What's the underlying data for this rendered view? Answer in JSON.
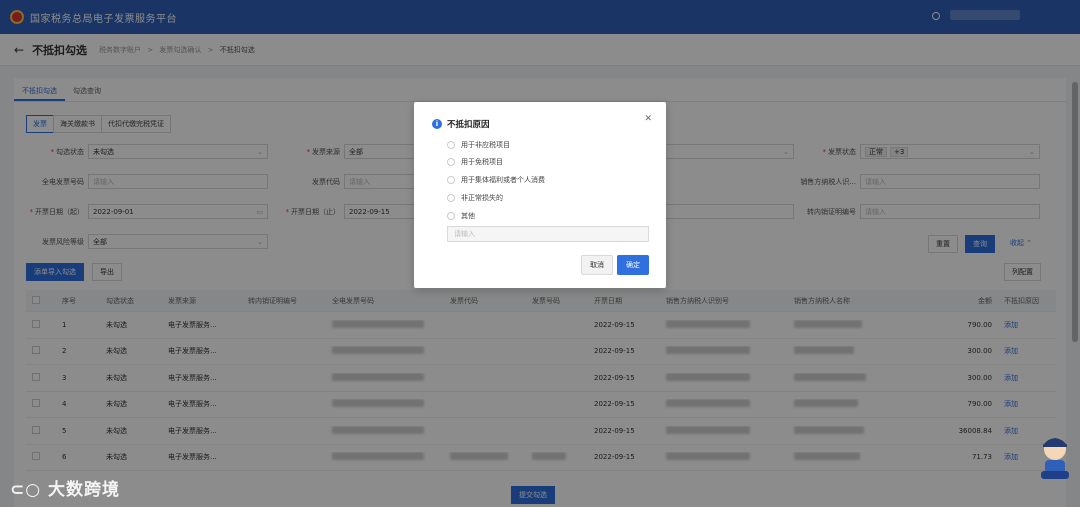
{
  "app": {
    "title": "国家税务总局电子发票服务平台"
  },
  "header": {
    "back_label": "←",
    "page_title": "不抵扣勾选",
    "breadcrumb": [
      "税务数字账户",
      "发票勾选确认",
      "不抵扣勾选"
    ],
    "breadcrumb_sep": ">"
  },
  "tabs": [
    "不抵扣勾选",
    "勾选查询"
  ],
  "subtabs": [
    "发票",
    "海关缴款书",
    "代扣代缴完税凭证"
  ],
  "filters": {
    "gouxuan_status": {
      "label": "勾选状态",
      "value": "未勾选"
    },
    "fapiao_source": {
      "label": "发票来源",
      "value": "全部"
    },
    "fapiao_status": {
      "label": "发票状态",
      "value": "正常",
      "extra": "+3"
    },
    "full_number": {
      "label": "全电发票号码",
      "placeholder": "请输入"
    },
    "fapiao_code": {
      "label": "发票代码",
      "placeholder": "请输入"
    },
    "seller_id": {
      "label": "销售方纳税人识...",
      "placeholder": "请输入"
    },
    "date_start": {
      "label": "开票日期（起）",
      "value": "2022-09-01"
    },
    "date_end": {
      "label": "开票日期（止）",
      "value": "2022-09-15"
    },
    "transfer_no": {
      "label": "转内销证明编号",
      "placeholder": "请输入"
    },
    "risk_level": {
      "label": "发票风险等级",
      "value": "全部"
    }
  },
  "buttons": {
    "reset": "重置",
    "query": "查询",
    "collapse": "收起",
    "add_import": "添单导入勾选",
    "export": "导出",
    "column_config": "列配置",
    "submit": "提交勾选"
  },
  "table": {
    "columns": [
      "序号",
      "勾选状态",
      "发票来源",
      "转内销证明编号",
      "全电发票号码",
      "发票代码",
      "发票号码",
      "开票日期",
      "销售方纳税人识别号",
      "销售方纳税人名称",
      "金额",
      "不抵扣原因"
    ],
    "rows": [
      {
        "no": "1",
        "status": "未勾选",
        "source": "电子发票服务...",
        "date": "2022-09-15",
        "amount": "790.00",
        "action": "添加"
      },
      {
        "no": "2",
        "status": "未勾选",
        "source": "电子发票服务...",
        "date": "2022-09-15",
        "amount": "300.00",
        "action": "添加"
      },
      {
        "no": "3",
        "status": "未勾选",
        "source": "电子发票服务...",
        "date": "2022-09-15",
        "amount": "300.00",
        "action": "添加"
      },
      {
        "no": "4",
        "status": "未勾选",
        "source": "电子发票服务...",
        "date": "2022-09-15",
        "amount": "790.00",
        "action": "添加"
      },
      {
        "no": "5",
        "status": "未勾选",
        "source": "电子发票服务...",
        "date": "2022-09-15",
        "amount": "36008.84",
        "action": "添加"
      },
      {
        "no": "6",
        "status": "未勾选",
        "source": "电子发票服务...",
        "date": "2022-09-15",
        "amount": "71.73",
        "action": "添加"
      }
    ]
  },
  "dialog": {
    "title": "不抵扣原因",
    "options": [
      "用于非应税项目",
      "用于免税项目",
      "用于集体福利或者个人消费",
      "非正常损失的",
      "其他"
    ],
    "input_placeholder": "请输入",
    "cancel": "取消",
    "confirm": "确定"
  },
  "watermark": "大数跨境"
}
